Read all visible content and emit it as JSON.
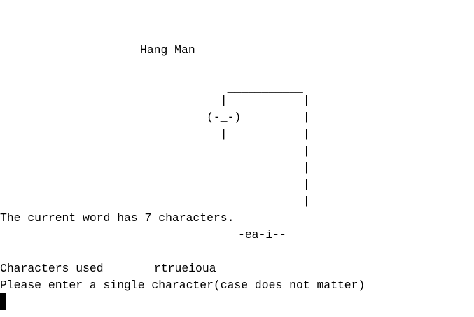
{
  "console": {
    "title": "Hang Man",
    "gallows": [
      "                                 ___________",
      "                                |           |",
      "                              (-_-)         |",
      "                                |           |",
      "                                            |",
      "                                            |",
      "                                            |",
      "                                            |"
    ],
    "word_length_message": "The current word has 7 characters.",
    "masked_word": "-ea-i--",
    "chars_used_label": "Characters used",
    "chars_used_value": "rtrueioua",
    "prompt": "Please enter a single character(case does not matter)"
  }
}
